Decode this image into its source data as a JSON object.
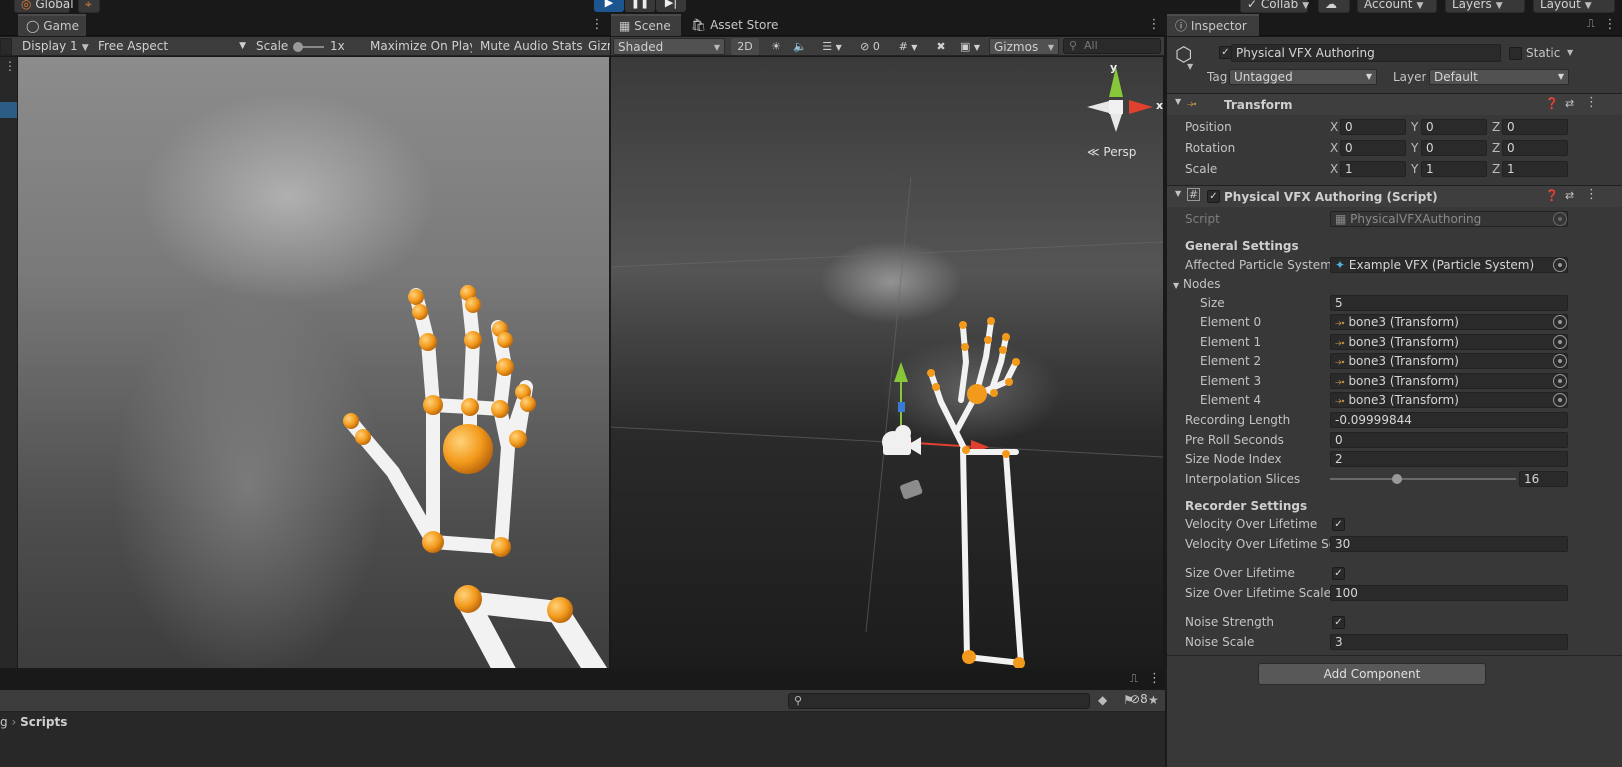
{
  "toolbar": {
    "global": "Global",
    "collab": "Collab",
    "account": "Account",
    "layers": "Layers",
    "layout": "Layout"
  },
  "game": {
    "tab": "Game",
    "display": "Display 1",
    "aspect": "Free Aspect",
    "scale_label": "Scale",
    "scale_value": "1x",
    "maximize": "Maximize On Play",
    "mute": "Mute Audio",
    "stats": "Stats",
    "gizmos": "Gizm"
  },
  "scene": {
    "tab": "Scene",
    "asset_store_tab": "Asset Store",
    "shading": "Shaded",
    "mode_2d": "2D",
    "hidden_count": "0",
    "gizmos": "Gizmos",
    "search_placeholder": "All",
    "persp": "Persp",
    "gizmo_y": "y",
    "gizmo_x": "x"
  },
  "project": {
    "breadcrumb_root": "g",
    "breadcrumb_folder": "Scripts",
    "hidden_count": "8"
  },
  "inspector": {
    "tab": "Inspector",
    "object_name": "Physical VFX Authoring",
    "static_label": "Static",
    "tag_label": "Tag",
    "tag_value": "Untagged",
    "layer_label": "Layer",
    "layer_value": "Default",
    "transform": {
      "title": "Transform",
      "position_label": "Position",
      "rotation_label": "Rotation",
      "scale_label": "Scale",
      "position": {
        "x": "0",
        "y": "0",
        "z": "0"
      },
      "rotation": {
        "x": "0",
        "y": "0",
        "z": "0"
      },
      "scale": {
        "x": "1",
        "y": "1",
        "z": "1"
      }
    },
    "script_component": {
      "title": "Physical VFX Authoring (Script)",
      "script_label": "Script",
      "script_value": "PhysicalVFXAuthoring",
      "general_header": "General Settings",
      "affected_label": "Affected Particle System",
      "affected_value": "Example VFX (Particle System)",
      "nodes_label": "Nodes",
      "size_label": "Size",
      "size_value": "5",
      "elements": [
        {
          "label": "Element 0",
          "value": "bone3 (Transform)"
        },
        {
          "label": "Element 1",
          "value": "bone3 (Transform)"
        },
        {
          "label": "Element 2",
          "value": "bone3 (Transform)"
        },
        {
          "label": "Element 3",
          "value": "bone3 (Transform)"
        },
        {
          "label": "Element 4",
          "value": "bone3 (Transform)"
        }
      ],
      "recording_length_label": "Recording Length",
      "recording_length_value": "-0.09999844",
      "pre_roll_label": "Pre Roll Seconds",
      "pre_roll_value": "0",
      "size_node_label": "Size Node Index",
      "size_node_value": "2",
      "interp_label": "Interpolation Slices",
      "interp_value": "16",
      "interp_fraction": 0.36,
      "recorder_header": "Recorder Settings",
      "vol_label": "Velocity Over Lifetime",
      "vol_checked": true,
      "vol_scale_label": "Velocity Over Lifetime Sca",
      "vol_scale_value": "30",
      "sol_label": "Size Over Lifetime",
      "sol_checked": true,
      "sol_scale_label": "Size Over Lifetime Scale",
      "sol_scale_value": "100",
      "noise_strength_label": "Noise Strength",
      "noise_strength_checked": true,
      "noise_scale_label": "Noise Scale",
      "noise_scale_value": "3"
    },
    "add_component": "Add Component"
  }
}
